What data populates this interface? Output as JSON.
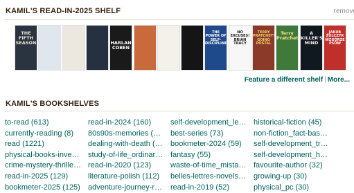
{
  "shelf": {
    "title": "KAMIL'S READ-IN-2025 SHELF",
    "remove_label": "remove",
    "covers": [
      {
        "icon": "book-cover-fifth-season",
        "text": "THE FIFTH SEASON",
        "bg": "#2a3440",
        "fg": "#e8e2d0"
      },
      {
        "icon": "book-cover-white-snow",
        "text": "",
        "bg": "#dfe6ee",
        "fg": "#6a7c90"
      },
      {
        "icon": "book-cover-pale",
        "text": "",
        "bg": "#ece7df",
        "fg": "#7d7568"
      },
      {
        "icon": "book-cover-dark-figure",
        "text": "",
        "bg": "#263040",
        "fg": "#c9d2dd"
      },
      {
        "icon": "book-cover-harlan-coben",
        "text": "HARLAN COBEN",
        "bg": "#1a1a1a",
        "fg": "#ffffff"
      },
      {
        "icon": "book-cover-red-hair",
        "text": "",
        "bg": "#c86a3c",
        "fg": "#ffffff"
      },
      {
        "icon": "book-cover-handwritten",
        "text": "",
        "bg": "#f4f1ea",
        "fg": "#555555"
      },
      {
        "icon": "book-cover-black-beast",
        "text": "",
        "bg": "#151515",
        "fg": "#d0d0d0"
      },
      {
        "icon": "book-cover-power-of-discipline",
        "text": "THE POWER OF SELF-DISCIPLINE",
        "bg": "#1e4a8c",
        "fg": "#ffffff"
      },
      {
        "icon": "book-cover-no-excuses",
        "text": "NO EXCUSES! BRIAN TRACY",
        "bg": "#f7f7f7",
        "fg": "#1a1a1a"
      },
      {
        "icon": "book-cover-going-postal",
        "text": "TERRY PRATCHETT GOING POSTAL",
        "bg": "#8b3a2a",
        "fg": "#f1d36a"
      },
      {
        "icon": "book-cover-terry-pratchett",
        "text": "Terry Pratchett",
        "bg": "#3f7a3a",
        "fg": "#f4e38a"
      },
      {
        "icon": "book-cover-killers-mind",
        "text": "A KILLER'S MIND",
        "bg": "#101820",
        "fg": "#f0f0f0"
      },
      {
        "icon": "book-cover-jakub-zulczyk",
        "text": "JAKUB ŻULCZYK WZGÓRZE PSÓW",
        "bg": "#c0302a",
        "fg": "#ffffff"
      }
    ],
    "feature_link": "Feature a different shelf",
    "more_link": "More..."
  },
  "bookshelves": {
    "title": "KAMIL'S BOOKSHELVES",
    "columns": [
      [
        "to-read (613)",
        "currently-reading (8)",
        "read (1221)",
        "physical-books-invent...",
        "crime-mystery-thriller...",
        "read-in-2025 (129)",
        "bookmeter-2025 (125)"
      ],
      [
        "read-in-2024 (160)",
        "80s90s-memories (15...",
        "dealing-with-death (1...",
        "study-of-life_ordinary...",
        "read-in-2020 (123)",
        "literature-polish (112)",
        "adventure-journey-ro..."
      ],
      [
        "self-development_lea...",
        "best-series (73)",
        "bookmeter-2024 (59)",
        "fantasy (55)",
        "waste-of-time_mistak...",
        "belles-lettres-novels (...",
        "read-in-2019 (52)"
      ],
      [
        "historical-fiction (45)",
        "non-fiction_fact-base...",
        "self-development_tre...",
        "self-development_hab...",
        "favourite-author (32)",
        "growing-up (30)",
        "physical_pc (30)"
      ]
    ]
  }
}
